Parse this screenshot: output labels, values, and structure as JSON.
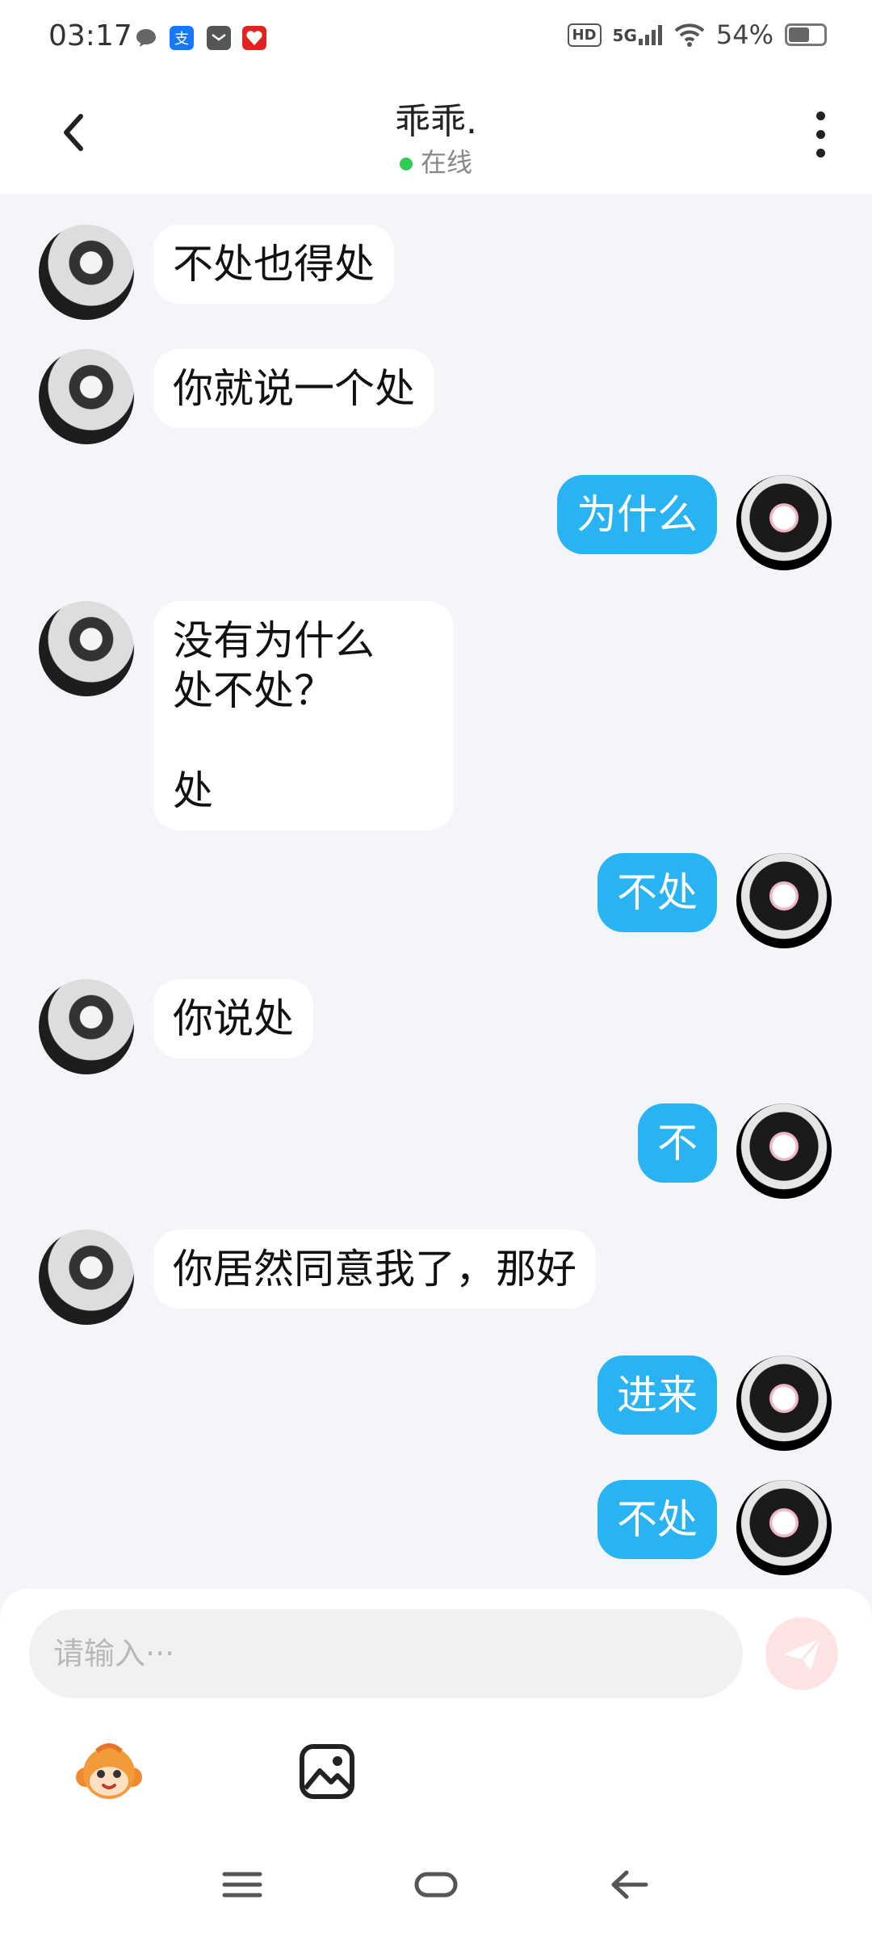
{
  "status_bar": {
    "time": "03:17",
    "network": "5G",
    "hd_label": "HD",
    "battery": "54%",
    "battery_level": 0.54
  },
  "header": {
    "title": "乖乖.",
    "status": "在线"
  },
  "messages": [
    {
      "from": "them",
      "text": "不处也得处"
    },
    {
      "from": "them",
      "text": "你就说一个处"
    },
    {
      "from": "me",
      "text": "为什么"
    },
    {
      "from": "them",
      "text": "没有为什么\n处不处？\n\n处"
    },
    {
      "from": "me",
      "text": "不处"
    },
    {
      "from": "them",
      "text": "你说处"
    },
    {
      "from": "me",
      "text": "不"
    },
    {
      "from": "them",
      "text": "你居然同意我了，那好"
    },
    {
      "from": "me",
      "text": "进来"
    },
    {
      "from": "me",
      "text": "不处"
    }
  ],
  "composer": {
    "placeholder": "请输入···"
  },
  "icons": {
    "back": "chevron-left-icon",
    "more": "more-vertical-icon",
    "send": "send-icon",
    "emoji": "monkey-emoji-icon",
    "image": "image-icon",
    "nav_menu": "menu-icon",
    "nav_home": "home-icon",
    "nav_back": "back-arrow-icon"
  },
  "colors": {
    "sent_bubble": "#29b3f2",
    "received_bubble": "#ffffff",
    "chat_background": "#f3f5f8",
    "online": "#2ecc52",
    "send_button": "#fde3e4"
  }
}
